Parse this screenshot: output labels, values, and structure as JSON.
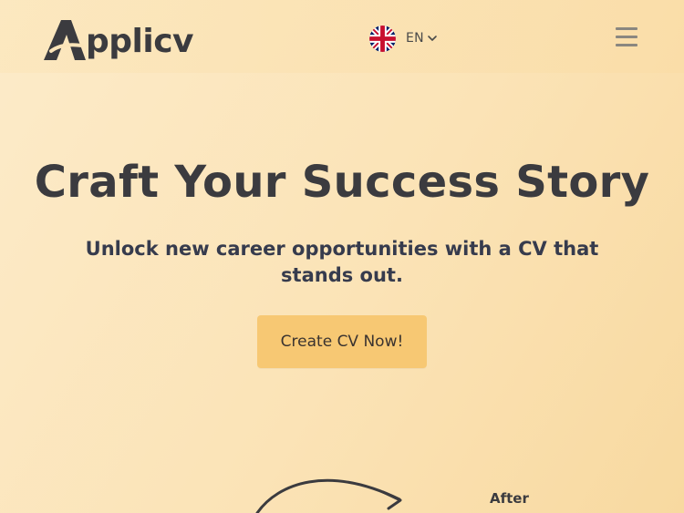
{
  "header": {
    "logo_text": "pplicv",
    "logo_letter": "A",
    "language": {
      "code": "EN",
      "flag_icon": "uk-flag-icon",
      "dropdown_icon": "chevron-down-icon"
    },
    "menu_icon": "hamburger-menu-icon"
  },
  "hero": {
    "title": "Craft Your Success Story",
    "subtitle": "Unlock new career opportunities with a CV that stands out.",
    "cta_label": "Create CV Now!"
  },
  "illustration": {
    "arrow_icon": "curved-arrow-icon",
    "after_label": "After"
  },
  "colors": {
    "background_start": "#fcebc9",
    "background_end": "#f8d9a0",
    "cta_bg": "#f7c873",
    "text_dark": "#3b3b3f"
  }
}
